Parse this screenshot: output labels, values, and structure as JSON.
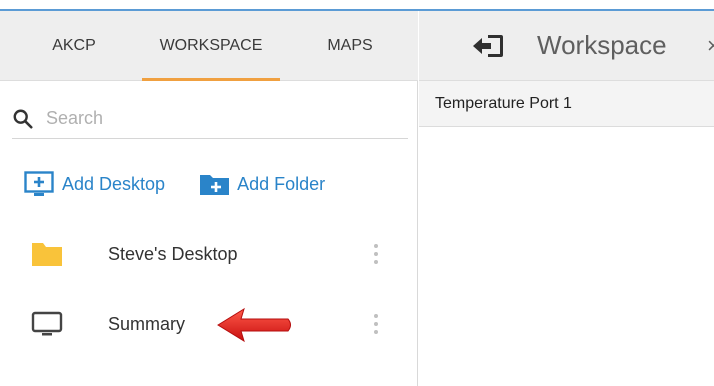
{
  "tabs": [
    {
      "label": "AKCP"
    },
    {
      "label": "WORKSPACE"
    },
    {
      "label": "MAPS"
    }
  ],
  "search": {
    "placeholder": "Search",
    "icon": "search-icon"
  },
  "actions": {
    "add_desktop": "Add Desktop",
    "add_folder": "Add Folder"
  },
  "items": [
    {
      "label": "Steve's Desktop",
      "icon": "folder-icon"
    },
    {
      "label": "Summary",
      "icon": "monitor-icon"
    }
  ],
  "panel": {
    "title": "Workspace",
    "close_glyph": "×",
    "port_label": "Temperature Port 1"
  },
  "colors": {
    "accent_tab": "#f0a040",
    "link_blue": "#2a84c9",
    "folder_yellow": "#f9c33a",
    "arrow_red": "#e8201a"
  }
}
